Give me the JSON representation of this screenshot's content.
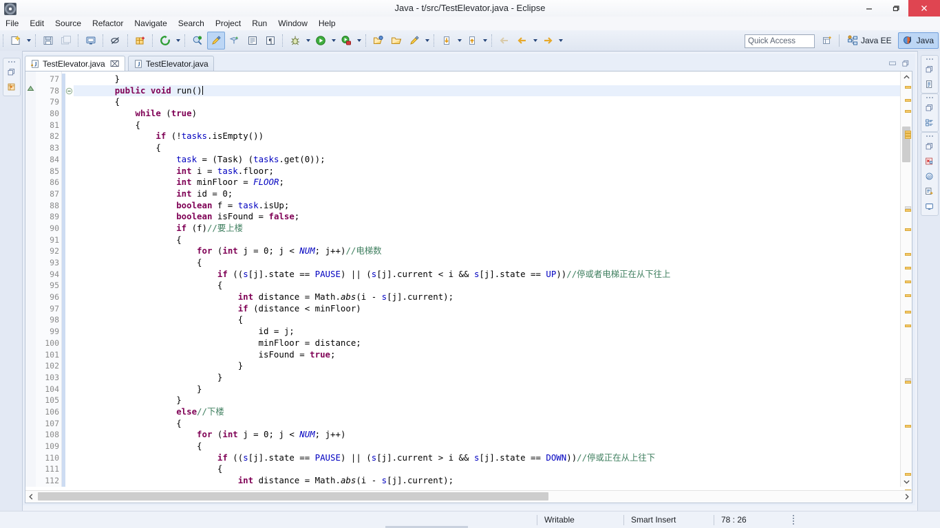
{
  "window": {
    "title": "Java - t/src/TestElevator.java - Eclipse",
    "icon": "eclipse-icon",
    "minimize_label": "Minimize",
    "restore_label": "Restore",
    "close_label": "Close"
  },
  "menubar": {
    "items": [
      {
        "label": "File",
        "name": "menu-file"
      },
      {
        "label": "Edit",
        "name": "menu-edit"
      },
      {
        "label": "Source",
        "name": "menu-source"
      },
      {
        "label": "Refactor",
        "name": "menu-refactor"
      },
      {
        "label": "Navigate",
        "name": "menu-navigate"
      },
      {
        "label": "Search",
        "name": "menu-search"
      },
      {
        "label": "Project",
        "name": "menu-project"
      },
      {
        "label": "Run",
        "name": "menu-run"
      },
      {
        "label": "Window",
        "name": "menu-window"
      },
      {
        "label": "Help",
        "name": "menu-help"
      }
    ]
  },
  "toolbar": {
    "quick_access_placeholder": "Quick Access",
    "perspectives": [
      {
        "label": "Java EE",
        "selected": false
      },
      {
        "label": "Java",
        "selected": true
      }
    ],
    "open_perspective_label": "Open Perspective"
  },
  "editor": {
    "tabs": [
      {
        "label": "TestElevator.java",
        "selected": true,
        "dirty": true,
        "close": "⌧"
      },
      {
        "label": "TestElevator.java",
        "selected": false,
        "dirty": false,
        "close": ""
      }
    ],
    "first_line": 77,
    "current_line": 78
  },
  "statusbar": {
    "writable": "Writable",
    "insert_mode": "Smart Insert",
    "position": "78 : 26"
  },
  "code": {
    "lines": [
      {
        "n": 77,
        "html": "        }"
      },
      {
        "n": 78,
        "html": "        <span class=\"kw\">public</span> <span class=\"kw\">void</span> run()<span class=\"cursor\"></span>",
        "current": true,
        "fold": true
      },
      {
        "n": 79,
        "html": "        {"
      },
      {
        "n": 80,
        "html": "            <span class=\"kw\">while</span> (<span class=\"kw\">true</span>)"
      },
      {
        "n": 81,
        "html": "            {"
      },
      {
        "n": 82,
        "html": "                <span class=\"kw\">if</span> (!<span class=\"fld\">tasks</span>.isEmpty())"
      },
      {
        "n": 83,
        "html": "                {"
      },
      {
        "n": 84,
        "html": "                    <span class=\"fld\">task</span> = (Task) (<span class=\"fld\">tasks</span>.get(0));"
      },
      {
        "n": 85,
        "html": "                    <span class=\"kw\">int</span> i = <span class=\"fld\">task</span>.floor;"
      },
      {
        "n": 86,
        "html": "                    <span class=\"kw\">int</span> minFloor = <span class=\"sfld\">FLOOR</span>;"
      },
      {
        "n": 87,
        "html": "                    <span class=\"kw\">int</span> id = 0;"
      },
      {
        "n": 88,
        "html": "                    <span class=\"kw\">boolean</span> f = <span class=\"fld\">task</span>.isUp;"
      },
      {
        "n": 89,
        "html": "                    <span class=\"kw\">boolean</span> isFound = <span class=\"kw\">false</span>;"
      },
      {
        "n": 90,
        "html": "                    <span class=\"kw\">if</span> (f)<span class=\"cmt\">//要上楼</span>"
      },
      {
        "n": 91,
        "html": "                    {"
      },
      {
        "n": 92,
        "html": "                        <span class=\"kw\">for</span> (<span class=\"kw\">int</span> j = 0; j &lt; <span class=\"sfld\">NUM</span>; j++)<span class=\"cmt\">//电梯数</span>"
      },
      {
        "n": 93,
        "html": "                        {"
      },
      {
        "n": 94,
        "html": "                            <span class=\"kw\">if</span> ((<span class=\"fld\">s</span>[j].state == <span class=\"fld\">PAUSE</span>) || (<span class=\"fld\">s</span>[j].current &lt; i &amp;&amp; <span class=\"fld\">s</span>[j].state == <span class=\"fld\">UP</span>))<span class=\"cmt\">//停或者电梯正在从下往上</span>"
      },
      {
        "n": 95,
        "html": "                            {"
      },
      {
        "n": 96,
        "html": "                                <span class=\"kw\">int</span> distance = Math.<span class=\"smeth\">abs</span>(i - <span class=\"fld\">s</span>[j].current);"
      },
      {
        "n": 97,
        "html": "                                <span class=\"kw\">if</span> (distance &lt; minFloor)"
      },
      {
        "n": 98,
        "html": "                                {"
      },
      {
        "n": 99,
        "html": "                                    id = j;"
      },
      {
        "n": 100,
        "html": "                                    minFloor = distance;"
      },
      {
        "n": 101,
        "html": "                                    isFound = <span class=\"kw\">true</span>;"
      },
      {
        "n": 102,
        "html": "                                }"
      },
      {
        "n": 103,
        "html": "                            }"
      },
      {
        "n": 104,
        "html": "                        }"
      },
      {
        "n": 105,
        "html": "                    }"
      },
      {
        "n": 106,
        "html": "                    <span class=\"kw\">else</span><span class=\"cmt\">//下楼</span>"
      },
      {
        "n": 107,
        "html": "                    {"
      },
      {
        "n": 108,
        "html": "                        <span class=\"kw\">for</span> (<span class=\"kw\">int</span> j = 0; j &lt; <span class=\"sfld\">NUM</span>; j++)"
      },
      {
        "n": 109,
        "html": "                        {"
      },
      {
        "n": 110,
        "html": "                            <span class=\"kw\">if</span> ((<span class=\"fld\">s</span>[j].state == <span class=\"fld\">PAUSE</span>) || (<span class=\"fld\">s</span>[j].current &gt; i &amp;&amp; <span class=\"fld\">s</span>[j].state == <span class=\"fld\">DOWN</span>))<span class=\"cmt\">//停或正在从上往下</span>"
      },
      {
        "n": 111,
        "html": "                            {"
      },
      {
        "n": 112,
        "html": "                                <span class=\"kw\">int</span> distance = Math.<span class=\"smeth\">abs</span>(i - <span class=\"fld\">s</span>[j].current);"
      }
    ]
  },
  "colors": {
    "keyword": "#7f0055",
    "field": "#0000c0",
    "comment": "#3f7f5f",
    "current_line": "#e8f0fc",
    "close_button": "#df4551",
    "accent": "#bcd6f5"
  },
  "overview_ruler": {
    "marks_y": [
      3,
      22,
      38,
      68,
      72,
      76,
      182,
      210,
      246,
      266,
      286,
      306,
      330,
      350,
      432,
      496,
      566,
      590
    ],
    "grey_marks_y": [
      178,
      428
    ]
  }
}
